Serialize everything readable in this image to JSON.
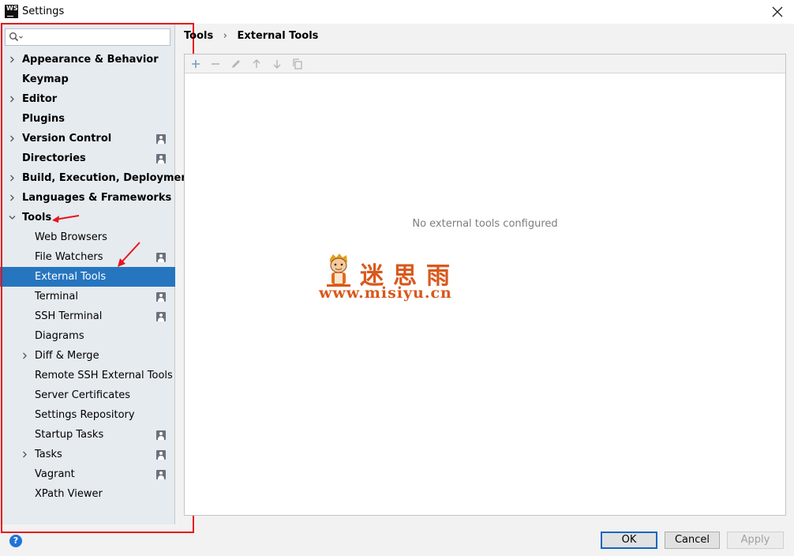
{
  "window": {
    "app_icon_text": "WS",
    "title": "Settings"
  },
  "search": {
    "value": "",
    "placeholder": ""
  },
  "tree": {
    "items": [
      {
        "label": "Appearance & Behavior",
        "level": 0,
        "expandable": true
      },
      {
        "label": "Keymap",
        "level": 0
      },
      {
        "label": "Editor",
        "level": 0,
        "expandable": true
      },
      {
        "label": "Plugins",
        "level": 0
      },
      {
        "label": "Version Control",
        "level": 0,
        "expandable": true,
        "project_icon": true
      },
      {
        "label": "Directories",
        "level": 0,
        "project_icon": true
      },
      {
        "label": "Build, Execution, Deployment",
        "level": 0,
        "expandable": true
      },
      {
        "label": "Languages & Frameworks",
        "level": 0,
        "expandable": true
      },
      {
        "label": "Tools",
        "level": 0,
        "expandable": true,
        "expanded": true
      },
      {
        "label": "Web Browsers",
        "level": 1
      },
      {
        "label": "File Watchers",
        "level": 1,
        "project_icon": true
      },
      {
        "label": "External Tools",
        "level": 1,
        "selected": true
      },
      {
        "label": "Terminal",
        "level": 1,
        "project_icon": true
      },
      {
        "label": "SSH Terminal",
        "level": 1,
        "project_icon": true
      },
      {
        "label": "Diagrams",
        "level": 1
      },
      {
        "label": "Diff & Merge",
        "level": 1,
        "expandable": true
      },
      {
        "label": "Remote SSH External Tools",
        "level": 1
      },
      {
        "label": "Server Certificates",
        "level": 1
      },
      {
        "label": "Settings Repository",
        "level": 1
      },
      {
        "label": "Startup Tasks",
        "level": 1,
        "project_icon": true
      },
      {
        "label": "Tasks",
        "level": 1,
        "expandable": true,
        "project_icon": true
      },
      {
        "label": "Vagrant",
        "level": 1,
        "project_icon": true
      },
      {
        "label": "XPath Viewer",
        "level": 1
      }
    ]
  },
  "breadcrumb": {
    "parent": "Tools",
    "current": "External Tools"
  },
  "toolbar": {
    "icons": [
      "add-icon",
      "remove-icon",
      "edit-icon",
      "move-up-icon",
      "move-down-icon",
      "copy-icon"
    ]
  },
  "main": {
    "empty_text": "No external tools configured"
  },
  "watermark": {
    "chars": "迷思雨",
    "url": "www.misiyu.cn"
  },
  "footer": {
    "help": "?",
    "ok": "OK",
    "cancel": "Cancel",
    "apply": "Apply"
  },
  "colors": {
    "selection": "#2675bf",
    "sidebar": "#e6ebf0",
    "annotation": "#e8141b",
    "watermark": "#d9581c"
  }
}
